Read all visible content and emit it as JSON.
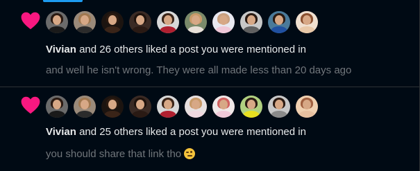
{
  "notifications": [
    {
      "actor": "Vivian",
      "action": " and 26 others liked a post you were mentioned in",
      "snippet": "and well he isn't wrong. They were all made less than 20 days ago",
      "avatars": [
        {
          "bg": "#6b6b6b",
          "hair": "#2a1a12",
          "body": "#1a1a1a"
        },
        {
          "bg": "#9a8a7a",
          "hair": "#a07850",
          "body": "#2b2b2b"
        },
        {
          "bg": "#1c1410",
          "hair": "#2b1a10",
          "body": "#3a2418"
        },
        {
          "bg": "#3a2a24",
          "hair": "#1e120c",
          "body": "#2a1a14"
        },
        {
          "bg": "#d8d8d8",
          "hair": "#3a2418",
          "body": "#b02030"
        },
        {
          "bg": "#7a8a6a",
          "hair": "#c89a6a",
          "body": "#e8e0d8"
        },
        {
          "bg": "#e8e8f0",
          "hair": "#c8a080",
          "body": "#f0c8d8"
        },
        {
          "bg": "#c8c8c8",
          "hair": "#2a1a12",
          "body": "#606060"
        },
        {
          "bg": "#4a7a9a",
          "hair": "#2a1a12",
          "body": "#2050a0"
        },
        {
          "bg": "#f0e0d0",
          "hair": "#8a5030",
          "body": "#e8c8a8"
        }
      ]
    },
    {
      "actor": "Vivian",
      "action": " and 25 others liked a post you were mentioned in",
      "snippet": "you should share that link tho",
      "avatars": [
        {
          "bg": "#6b6b6b",
          "hair": "#2a1a12",
          "body": "#1a1a1a"
        },
        {
          "bg": "#9a8a7a",
          "hair": "#a07850",
          "body": "#2b2b2b"
        },
        {
          "bg": "#1c1410",
          "hair": "#2b1a10",
          "body": "#3a2418"
        },
        {
          "bg": "#3a2a24",
          "hair": "#1e120c",
          "body": "#2a1a14"
        },
        {
          "bg": "#d8d8d8",
          "hair": "#3a2418",
          "body": "#b02030"
        },
        {
          "bg": "#e8e0e0",
          "hair": "#c89a6a",
          "body": "#f0d8e0"
        },
        {
          "bg": "#f0e8e8",
          "hair": "#d06060",
          "body": "#f0c8d8"
        },
        {
          "bg": "#b0d080",
          "hair": "#2a1a12",
          "body": "#e8e020"
        },
        {
          "bg": "#c8c8c8",
          "hair": "#2a1a12",
          "body": "#8a8a8a"
        },
        {
          "bg": "#f0d0b0",
          "hair": "#a06040",
          "body": "#e8c0a0"
        }
      ]
    }
  ],
  "heart_color": "#f91880",
  "accent_color": "#1d9bf0",
  "emoji": "winking-face"
}
